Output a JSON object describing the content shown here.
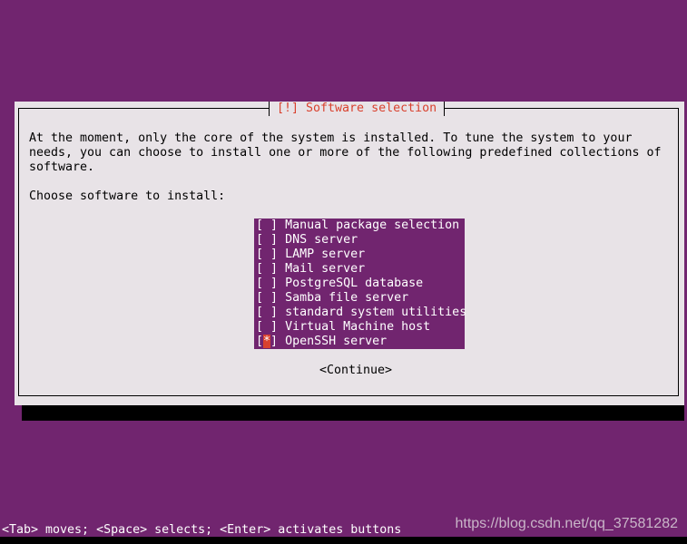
{
  "dialog": {
    "title": "[!] Software selection",
    "description_lines": [
      "At the moment, only the core of the system is installed. To tune the system to your",
      "needs, you can choose to install one or more of the following predefined collections of",
      "software."
    ],
    "prompt": "Choose software to install:",
    "items": [
      {
        "label": "Manual package selection",
        "checked": false
      },
      {
        "label": "DNS server",
        "checked": false
      },
      {
        "label": "LAMP server",
        "checked": false
      },
      {
        "label": "Mail server",
        "checked": false
      },
      {
        "label": "PostgreSQL database",
        "checked": false
      },
      {
        "label": "Samba file server",
        "checked": false
      },
      {
        "label": "standard system utilities",
        "checked": false
      },
      {
        "label": "Virtual Machine host",
        "checked": false
      },
      {
        "label": "OpenSSH server",
        "checked": true
      }
    ],
    "continue_label": "<Continue>"
  },
  "footer": {
    "help": "<Tab> moves; <Space> selects; <Enter> activates buttons"
  },
  "watermark": "https://blog.csdn.net/qq_37581282",
  "colors": {
    "background": "#71256f",
    "dialog": "#e8e3e7",
    "accent": "#d9412e"
  }
}
